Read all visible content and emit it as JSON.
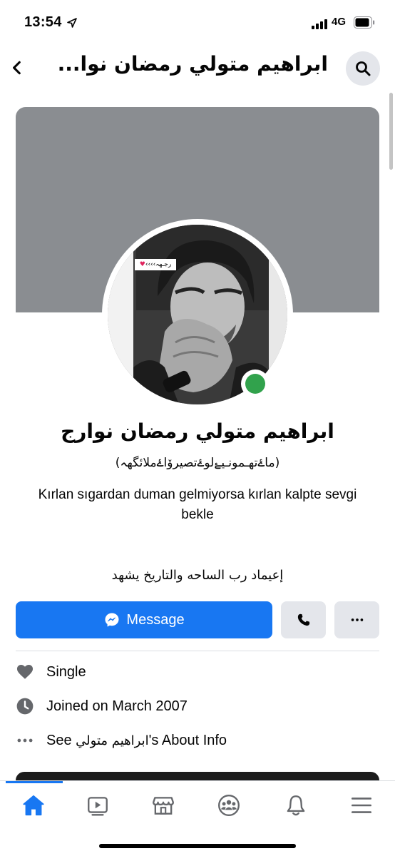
{
  "status_bar": {
    "time": "13:54",
    "network": "4G"
  },
  "header": {
    "title": "ابراهيم متولي رمضان نوا..."
  },
  "profile": {
    "name": "ابراهيم متولي رمضان نوارج",
    "alt_name": "(ماۓتهـمونـيۓلوۓتصيرۆاۓملائگهہ)",
    "bio": "Kırlan sıgardan  duman gelmiyorsa kırlan kalpte sevgi bekle",
    "bio_arabic": "إعيماد رب الساحه والتاريخ يشهد",
    "avatar_caption": "رجـهہ››››",
    "online": true
  },
  "actions": {
    "message_label": "Message"
  },
  "info": {
    "relationship": "Single",
    "joined": "Joined on March 2007",
    "about_prefix": "See ",
    "about_name": "ابراهيم متولي",
    "about_suffix": "'s About Info"
  },
  "tabs": [
    {
      "icon": "home-icon",
      "active": true
    },
    {
      "icon": "watch-icon",
      "active": false
    },
    {
      "icon": "marketplace-icon",
      "active": false
    },
    {
      "icon": "groups-icon",
      "active": false
    },
    {
      "icon": "notifications-icon",
      "active": false
    },
    {
      "icon": "menu-icon",
      "active": false
    }
  ],
  "colors": {
    "accent": "#1877f2",
    "online": "#31a24c",
    "cover": "#8a8d91",
    "button_secondary": "#e4e6eb"
  }
}
